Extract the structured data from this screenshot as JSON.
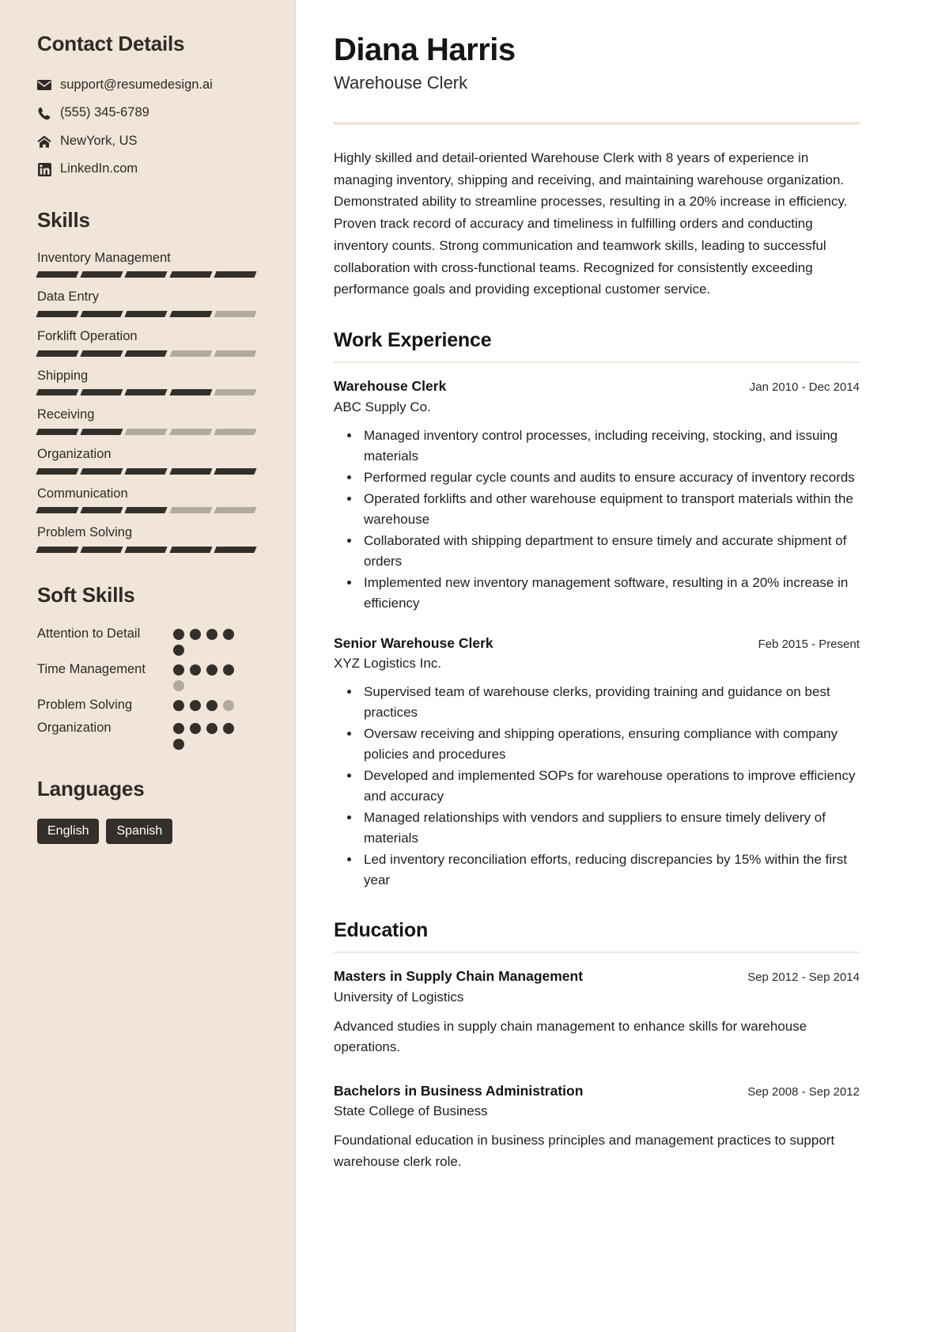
{
  "colors": {
    "sidebar_bg": "#f0e5d8",
    "ink": "#2e2a26",
    "accent_rule": "#f0e5d8",
    "bar_on": "#332f2b",
    "bar_off": "#b3aa9e",
    "tag_bg": "#332f2b"
  },
  "sidebar": {
    "contact": {
      "heading": "Contact Details",
      "items": [
        {
          "icon": "envelope-icon",
          "text": "support@resumedesign.ai"
        },
        {
          "icon": "phone-icon",
          "text": "(555) 345-6789"
        },
        {
          "icon": "home-icon",
          "text": "NewYork, US"
        },
        {
          "icon": "linkedin-icon",
          "text": "LinkedIn.com"
        }
      ]
    },
    "skills": {
      "heading": "Skills",
      "segments_total": 5,
      "items": [
        {
          "label": "Inventory Management",
          "filled": 5
        },
        {
          "label": "Data Entry",
          "filled": 4
        },
        {
          "label": "Forklift Operation",
          "filled": 3
        },
        {
          "label": "Shipping",
          "filled": 4
        },
        {
          "label": "Receiving",
          "filled": 2
        },
        {
          "label": "Organization",
          "filled": 5
        },
        {
          "label": "Communication",
          "filled": 3
        },
        {
          "label": "Problem Solving",
          "filled": 5
        }
      ]
    },
    "soft_skills": {
      "heading": "Soft Skills",
      "dots_total": 5,
      "items": [
        {
          "label": "Attention to Detail",
          "filled": 5,
          "shown": 5
        },
        {
          "label": "Time Management",
          "filled": 4,
          "shown": 5
        },
        {
          "label": "Problem Solving",
          "filled": 3,
          "shown": 4
        },
        {
          "label": "Organization",
          "filled": 5,
          "shown": 5
        }
      ]
    },
    "languages": {
      "heading": "Languages",
      "items": [
        "English",
        "Spanish"
      ]
    }
  },
  "main": {
    "name": "Diana Harris",
    "job_title": "Warehouse Clerk",
    "summary": "Highly skilled and detail-oriented Warehouse Clerk with 8 years of experience in managing inventory, shipping and receiving, and maintaining warehouse organization. Demonstrated ability to streamline processes, resulting in a 20% increase in efficiency. Proven track record of accuracy and timeliness in fulfilling orders and conducting inventory counts. Strong communication and teamwork skills, leading to successful collaboration with cross-functional teams. Recognized for consistently exceeding performance goals and providing exceptional customer service.",
    "work": {
      "heading": "Work Experience",
      "entries": [
        {
          "role": "Warehouse Clerk",
          "date": "Jan 2010 - Dec 2014",
          "org": "ABC Supply Co.",
          "bullets": [
            "Managed inventory control processes, including receiving, stocking, and issuing materials",
            "Performed regular cycle counts and audits to ensure accuracy of inventory records",
            "Operated forklifts and other warehouse equipment to transport materials within the warehouse",
            "Collaborated with shipping department to ensure timely and accurate shipment of orders",
            "Implemented new inventory management software, resulting in a 20% increase in efficiency"
          ]
        },
        {
          "role": "Senior Warehouse Clerk",
          "date": "Feb 2015 - Present",
          "org": "XYZ Logistics Inc.",
          "bullets": [
            "Supervised team of warehouse clerks, providing training and guidance on best practices",
            "Oversaw receiving and shipping operations, ensuring compliance with company policies and procedures",
            "Developed and implemented SOPs for warehouse operations to improve efficiency and accuracy",
            "Managed relationships with vendors and suppliers to ensure timely delivery of materials",
            "Led inventory reconciliation efforts, reducing discrepancies by 15% within the first year"
          ]
        }
      ]
    },
    "education": {
      "heading": "Education",
      "entries": [
        {
          "degree": "Masters in Supply Chain Management",
          "date": "Sep 2012 - Sep 2014",
          "school": "University of Logistics",
          "description": "Advanced studies in supply chain management to enhance skills for warehouse operations."
        },
        {
          "degree": "Bachelors in Business Administration",
          "date": "Sep 2008 - Sep 2012",
          "school": "State College of Business",
          "description": "Foundational education in business principles and management practices to support warehouse clerk role."
        }
      ]
    }
  }
}
